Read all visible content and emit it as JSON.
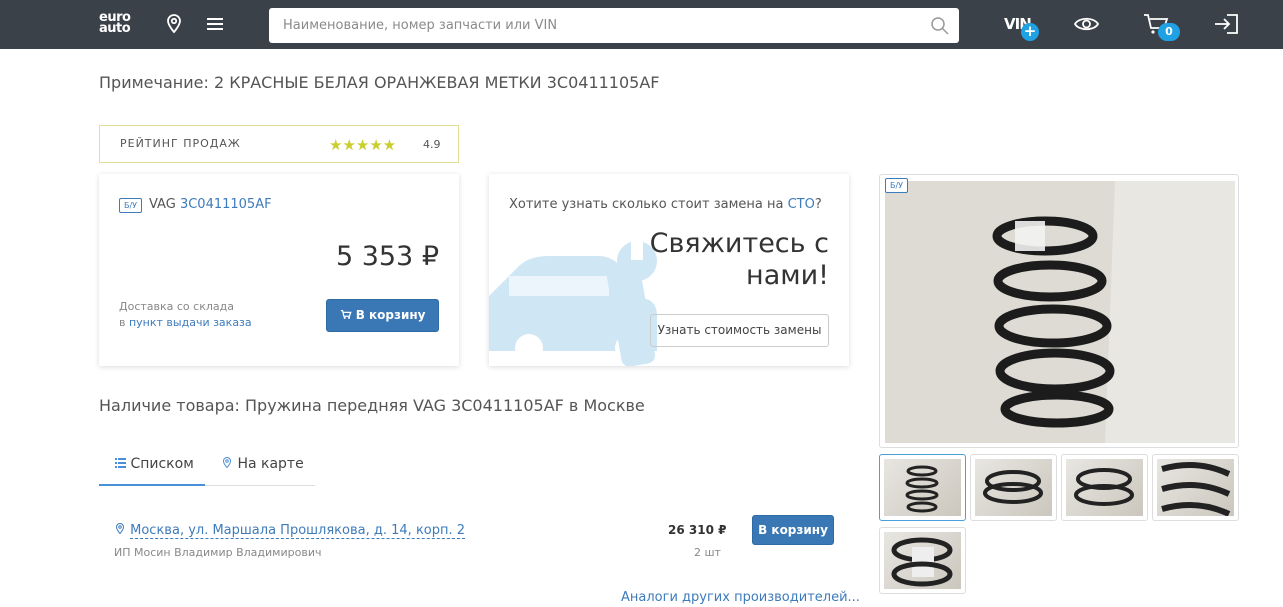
{
  "header": {
    "logo_line1": "euro",
    "logo_line2": "auto",
    "search_placeholder": "Наименование, номер запчасти или VIN",
    "vin_label": "VIN",
    "vin_plus": "+",
    "cart_count": "0",
    "icons": [
      "location-icon",
      "menu-icon",
      "search-icon",
      "eye-icon",
      "cart-icon",
      "login-icon"
    ]
  },
  "note": "Примечание: 2 КРАСНЫЕ БЕЛАЯ ОРАНЖЕВАЯ МЕТКИ 3C0411105AF",
  "rating": {
    "label": "РЕЙТИНГ ПРОДАЖ",
    "stars": "★★★★★",
    "value": "4.9",
    "star_color": "#c9cf2e"
  },
  "buy_card": {
    "condition_tag": "Б/У",
    "brand": "VAG",
    "part_number": "3C0411105AF",
    "price": "5 353 ₽",
    "delivery_text": "Доставка со склада",
    "delivery_prefix": "в ",
    "delivery_link": "пункт выдачи заказа",
    "cart_button": "В корзину"
  },
  "sto_card": {
    "question_prefix": "Хотите узнать сколько стоит замена на ",
    "question_link": "СТО",
    "question_suffix": "?",
    "title_line1": "Свяжитесь с",
    "title_line2": "нами!",
    "button": "Узнать стоимость замены"
  },
  "availability": "Наличие товара: Пружина передняя VAG 3C0411105AF в Москве",
  "tabs": [
    {
      "label": "Списком",
      "icon": "list-icon",
      "active": true
    },
    {
      "label": "На карте",
      "icon": "map-pin-icon",
      "active": false
    }
  ],
  "offer": {
    "address": "Москва, ул. Маршала Прошлякова, д. 14, корп. 2",
    "seller": "ИП Мосин Владимир Владимирович",
    "price": "26 310 ₽",
    "qty": "2 шт",
    "cart_button": "В корзину"
  },
  "analogs_link": "Аналоги других производителей...",
  "gallery": {
    "condition_tag": "Б/У",
    "thumb_count": 5
  },
  "colors": {
    "header_bg": "#3a4149",
    "accent_blue": "#3a78b5",
    "link_blue": "#3e7bbb",
    "badge_blue": "#1fa1e4"
  }
}
